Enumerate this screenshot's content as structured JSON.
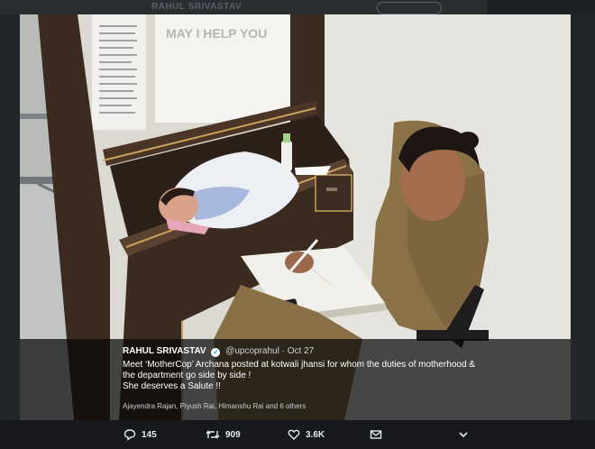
{
  "header": {
    "author_name_ghost": "RAHUL SRIVASTAV"
  },
  "photo": {
    "sign_text": "MAY I HELP YOU"
  },
  "tweet": {
    "author_name": "RAHUL SRIVASTAV",
    "handle": "@upcoprahul",
    "separator": "·",
    "date": "Oct 27",
    "text_line1": "Meet ‘MotherCop’ Archana posted at kotwali jhansi for whom the duties of motherhood &",
    "text_line2": "the department go side by side !",
    "text_line3": "She deserves a Salute !!",
    "tagged": "Ajayendra Rajan, Piyush Rai, Himanshu Rai and 6 others"
  },
  "actions": {
    "replies": "145",
    "retweets": "909",
    "likes": "3.6K"
  },
  "colors": {
    "accent": "#1da1f2",
    "background": "#16181b"
  },
  "icons": [
    "reply-icon",
    "retweet-icon",
    "heart-icon",
    "mail-icon",
    "chevron-down-icon",
    "verified-icon"
  ]
}
